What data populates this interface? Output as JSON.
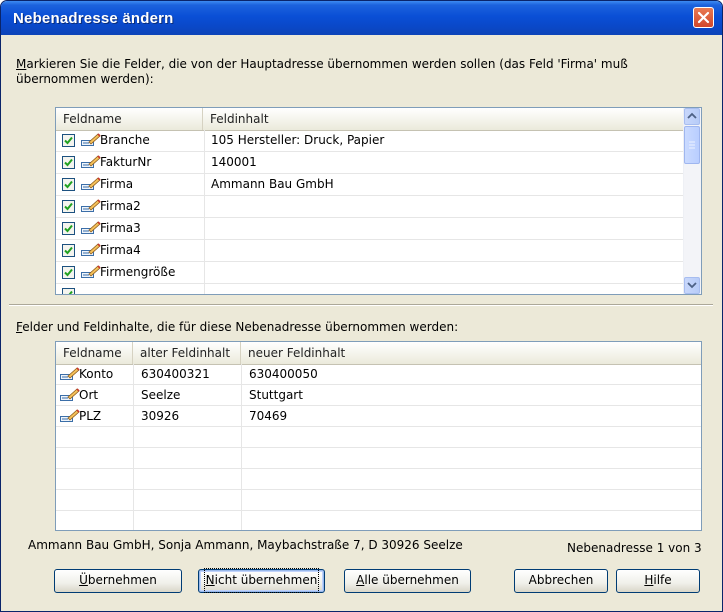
{
  "window": {
    "title": "Nebenadresse ändern"
  },
  "instruction": {
    "first_char": "M",
    "text_rest": "arkieren Sie die Felder, die von der Hauptadresse übernommen werden sollen (das Feld 'Firma' muß übernommen werden):"
  },
  "top_list": {
    "columns": [
      "Feldname",
      "Feldinhalt"
    ],
    "rows": [
      {
        "name": "Branche",
        "value": "105 Hersteller: Druck, Papier",
        "checked": true
      },
      {
        "name": "FakturNr",
        "value": "140001",
        "checked": true
      },
      {
        "name": "Firma",
        "value": "Ammann Bau GmbH",
        "checked": true
      },
      {
        "name": "Firma2",
        "value": "",
        "checked": true
      },
      {
        "name": "Firma3",
        "value": "",
        "checked": true
      },
      {
        "name": "Firma4",
        "value": "",
        "checked": true
      },
      {
        "name": "Firmengröße",
        "value": "",
        "checked": true
      }
    ]
  },
  "bottom_label": {
    "first_char": "F",
    "text_rest": "elder und Feldinhalte, die für diese Nebenadresse übernommen werden:"
  },
  "bottom_list": {
    "columns": [
      "Feldname",
      "alter Feldinhalt",
      "neuer Feldinhalt"
    ],
    "rows": [
      {
        "name": "Konto",
        "old": "630400321",
        "new": "630400050"
      },
      {
        "name": "Ort",
        "old": "Seelze",
        "new": "Stuttgart"
      },
      {
        "name": "PLZ",
        "old": "30926",
        "new": "70469"
      }
    ]
  },
  "status": {
    "address": "Ammann Bau GmbH, Sonja Ammann, Maybachstraße 7, D 30926 Seelze",
    "counter": "Nebenadresse 1 von 3"
  },
  "buttons": {
    "uebernehmen": {
      "first": "Ü",
      "rest": "bernehmen"
    },
    "nicht_uebernehmen": {
      "first": "N",
      "rest": "icht übernehmen"
    },
    "alle_uebernehmen": {
      "first": "A",
      "rest": "lle übernehmen"
    },
    "abbrechen": {
      "label": "Abbrechen"
    },
    "hilfe": {
      "first": "H",
      "rest": "ilfe"
    }
  },
  "colors": {
    "titlebar": "#0a4fd6",
    "face": "#ece9d8",
    "list_border": "#7f9db9",
    "check": "#21a121"
  }
}
